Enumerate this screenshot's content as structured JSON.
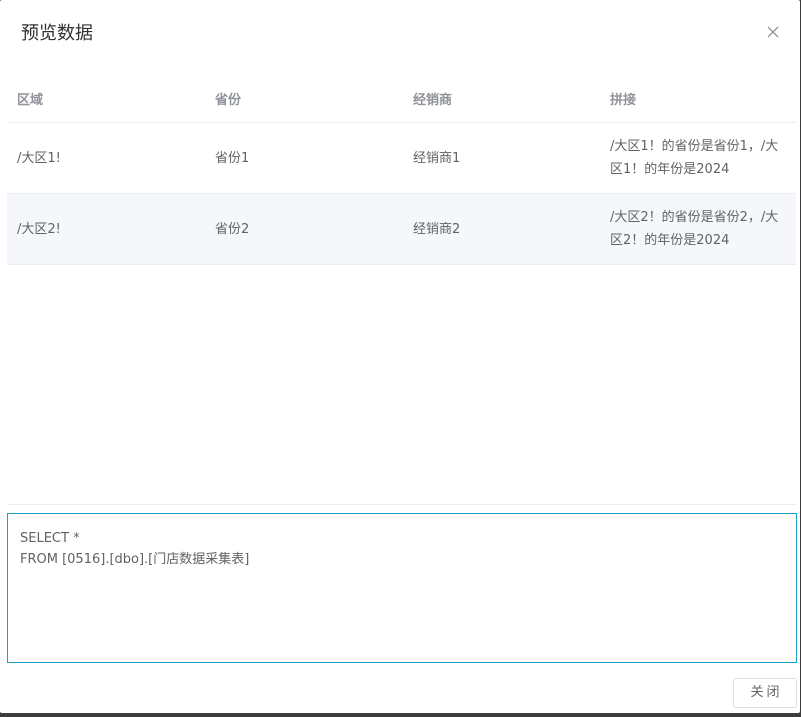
{
  "dialog": {
    "title": "预览数据",
    "close_icon": "close-icon"
  },
  "table": {
    "headers": [
      "区域",
      "省份",
      "经销商",
      "拼接"
    ],
    "rows": [
      [
        "/大区1!",
        "省份1",
        "经销商1",
        "/大区1！的省份是省份1，/大区1！的年份是2024"
      ],
      [
        "/大区2!",
        "省份2",
        "经销商2",
        "/大区2！的省份是省份2，/大区2！的年份是2024"
      ]
    ]
  },
  "sql": {
    "text": "SELECT *\nFROM [0516].[dbo].[门店数据采集表]"
  },
  "footer": {
    "close_label": "关闭"
  },
  "colors": {
    "accent_border": "#1aa0c6",
    "stripe": "#f5f7fa",
    "header_text": "#909399"
  }
}
